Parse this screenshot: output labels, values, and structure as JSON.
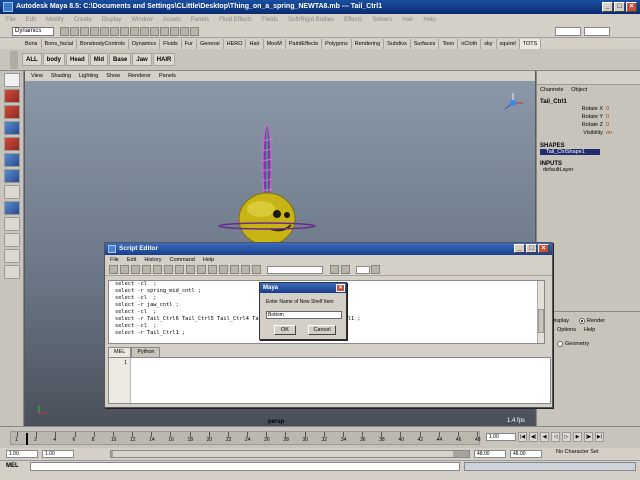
{
  "window": {
    "title": "Autodesk Maya 8.5: C:\\Documents and Settings\\CLittle\\Desktop\\Thing_on_a_spring_NEWTA8.mb   ---   Tail_Ctrl1"
  },
  "menubar": {
    "items": [
      "File",
      "Edit",
      "Modify",
      "Create",
      "Display",
      "Window",
      "Assets",
      "Panels",
      "Fluid Effects",
      "Fields",
      "Soft/Rigid Bodies",
      "Effects",
      "Solvers",
      "Hair",
      "Help"
    ]
  },
  "statusline": {
    "mode": "Dynamics"
  },
  "shelf": {
    "tabs": [
      "Bons",
      "Bons_facial",
      "BonsbodyControls",
      "Dynamics",
      "Fluids",
      "Fur",
      "General",
      "HERO",
      "Hair",
      "MooM",
      "PaintEffects",
      "Polygons",
      "Rendering",
      "Subdivs",
      "Surfaces",
      "Toon",
      "nCloth",
      "sky",
      "squirel",
      "TOTS"
    ],
    "active_tab": "TOTS",
    "items": [
      "ALL",
      "body",
      "Head",
      "Mid",
      "Base",
      "Jaw",
      "HAIR"
    ]
  },
  "panel": {
    "menus": [
      "View",
      "Shading",
      "Lighting",
      "Show",
      "Renderer",
      "Panels"
    ],
    "camera": "persp",
    "fps": "1.4 fps"
  },
  "channelbox": {
    "menus": [
      "Channels",
      "Object"
    ],
    "object_name": "Tail_Ctrl1",
    "attributes": [
      {
        "name": "Rotate X",
        "value": "0"
      },
      {
        "name": "Rotate Y",
        "value": "0"
      },
      {
        "name": "Rotate Z",
        "value": "0"
      },
      {
        "name": "Visibility",
        "value": "on"
      }
    ],
    "shapes_label": "SHAPES",
    "shape_item": "Tail_CtrlShape1",
    "inputs_label": "INPUTS",
    "input_item": "defaultLayer"
  },
  "layers": {
    "display_label": "Display",
    "render_label": "Render",
    "menus": [
      "Options",
      "Help"
    ],
    "item": "Geometry"
  },
  "timeline": {
    "ticks": [
      "1",
      "2",
      "4",
      "6",
      "8",
      "10",
      "12",
      "14",
      "16",
      "18",
      "20",
      "22",
      "24",
      "26",
      "28",
      "30",
      "32",
      "34",
      "36",
      "38",
      "40",
      "42",
      "44",
      "46",
      "48"
    ],
    "current_frame": "1.00"
  },
  "range": {
    "start": "1.00",
    "inner_start": "1.00",
    "end": "48.00",
    "inner_end": "48.00",
    "charset": "No Character Set"
  },
  "cmdline": {
    "label": "MEL"
  },
  "script_editor": {
    "title": "Script Editor",
    "menus": [
      "File",
      "Edit",
      "History",
      "Command",
      "Help"
    ],
    "history": [
      "select -cl  ;",
      "select -r spring_mid_cntl ;",
      "select -cl  ;",
      "select -r jaw_cntl ;",
      "select -cl  ;",
      "select -r Tail_Ctrl6 Tail_Ctrl5 Tail_Ctrl4 Tail_Ctrl3 Tail_Ctrl2 Tail_Ctrl1 ;",
      "select -cl  ;",
      "select -r Tail_Ctrl1 ;"
    ],
    "tabs": [
      "MEL",
      "Python"
    ],
    "line_number": "1"
  },
  "dialog": {
    "title": "Maya",
    "message": "Enter Name of New Shelf Item",
    "input_value": "Bottom",
    "ok_label": "OK",
    "cancel_label": "Cancel"
  }
}
